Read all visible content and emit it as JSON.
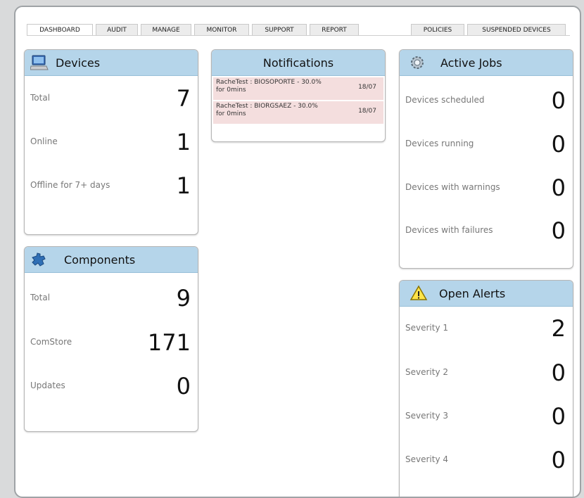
{
  "tabs_left": [
    {
      "label": "DASHBOARD",
      "active": true
    },
    {
      "label": "AUDIT"
    },
    {
      "label": "MANAGE"
    },
    {
      "label": "MONITOR"
    },
    {
      "label": "SUPPORT"
    },
    {
      "label": "REPORT"
    }
  ],
  "tabs_right": [
    {
      "label": "POLICIES"
    },
    {
      "label": "SUSPENDED DEVICES"
    }
  ],
  "devices": {
    "title": "Devices",
    "icon": "computer-icon",
    "rows": [
      {
        "label": "Total",
        "value": "7"
      },
      {
        "label": "Online",
        "value": "1"
      },
      {
        "label": "Offline for 7+ days",
        "value": "1"
      }
    ]
  },
  "components": {
    "title": "Components",
    "icon": "puzzle-icon",
    "rows": [
      {
        "label": "Total",
        "value": "9"
      },
      {
        "label": "ComStore",
        "value": "171"
      },
      {
        "label": "Updates",
        "value": "0"
      }
    ]
  },
  "notifications": {
    "title": "Notifications",
    "items": [
      {
        "message": "RacheTest : BIOSOPORTE - 30.0% for 0mins",
        "date": "18/07"
      },
      {
        "message": "RacheTest : BIORGSAEZ - 30.0% for 0mins",
        "date": "18/07"
      }
    ]
  },
  "active_jobs": {
    "title": "Active Jobs",
    "icon": "gear-icon",
    "rows": [
      {
        "label": "Devices scheduled",
        "value": "0"
      },
      {
        "label": "Devices running",
        "value": "0"
      },
      {
        "label": "Devices with warnings",
        "value": "0"
      },
      {
        "label": "Devices with failures",
        "value": "0"
      }
    ]
  },
  "open_alerts": {
    "title": "Open Alerts",
    "icon": "warning-icon",
    "rows": [
      {
        "label": "Severity 1",
        "value": "2"
      },
      {
        "label": "Severity 2",
        "value": "0"
      },
      {
        "label": "Severity 3",
        "value": "0"
      },
      {
        "label": "Severity 4",
        "value": "0"
      }
    ]
  },
  "colors": {
    "panel_header": "#b5d5ea",
    "notification_bg": "#f4dede"
  }
}
